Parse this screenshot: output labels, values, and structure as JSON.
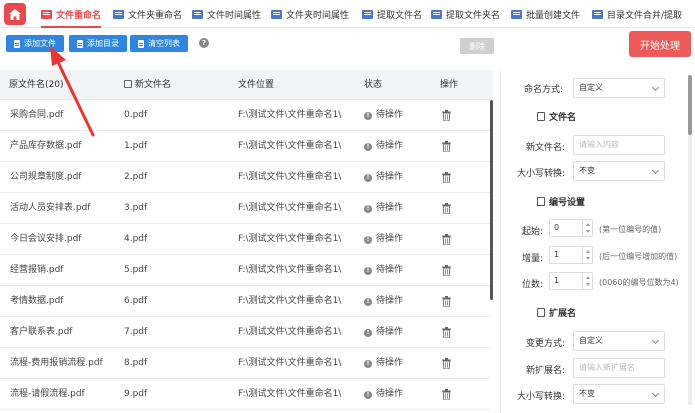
{
  "nav": {
    "tabs": [
      {
        "label": "文件重命名",
        "active": true
      },
      {
        "label": "文件夹重命名"
      },
      {
        "label": "文件时间属性"
      },
      {
        "label": "文件夹时间属性"
      },
      {
        "label": "提取文件名"
      },
      {
        "label": "提取文件夹名"
      },
      {
        "label": "批量创建文件"
      },
      {
        "label": "目录文件合并/提取"
      }
    ]
  },
  "toolbar": {
    "add_file": "添加文件",
    "add_folder": "添加目录",
    "clear_list": "清空列表",
    "help": "?",
    "delete": "删除",
    "start": "开始处理"
  },
  "table": {
    "headers": [
      "原文件名(20)",
      "新文件名",
      "文件位置",
      "状态",
      "操作"
    ],
    "rows": [
      {
        "orig": "采购合同.pdf",
        "new": "0.pdf",
        "path": "F:\\测试文件\\文件重命名1\\",
        "status": "待操作"
      },
      {
        "orig": "产品库存数据.pdf",
        "new": "1.pdf",
        "path": "F:\\测试文件\\文件重命名1\\",
        "status": "待操作"
      },
      {
        "orig": "公司规章制度.pdf",
        "new": "2.pdf",
        "path": "F:\\测试文件\\文件重命名1\\",
        "status": "待操作"
      },
      {
        "orig": "活动人员安排表.pdf",
        "new": "3.pdf",
        "path": "F:\\测试文件\\文件重命名1\\",
        "status": "待操作"
      },
      {
        "orig": "今日会议安排.pdf",
        "new": "4.pdf",
        "path": "F:\\测试文件\\文件重命名1\\",
        "status": "待操作"
      },
      {
        "orig": "经营报销.pdf",
        "new": "5.pdf",
        "path": "F:\\测试文件\\文件重命名1\\",
        "status": "待操作"
      },
      {
        "orig": "考情数据.pdf",
        "new": "6.pdf",
        "path": "F:\\测试文件\\文件重命名1\\",
        "status": "待操作"
      },
      {
        "orig": "客户联系表.pdf",
        "new": "7.pdf",
        "path": "F:\\测试文件\\文件重命名1\\",
        "status": "待操作"
      },
      {
        "orig": "流程-费用报销流程.pdf",
        "new": "8.pdf",
        "path": "F:\\测试文件\\文件重命名1\\",
        "status": "待操作"
      },
      {
        "orig": "流程-请假流程.pdf",
        "new": "9.pdf",
        "path": "F:\\测试文件\\文件重命名1\\",
        "status": "待操作"
      }
    ]
  },
  "panel": {
    "naming_mode_label": "命名方式:",
    "naming_mode_value": "自定义",
    "filename_section": "文件名",
    "new_name_label": "新文件名:",
    "new_name_placeholder": "请输入内容",
    "case_label": "大小写转换:",
    "case_value": "不变",
    "number_section": "编号设置",
    "start_label": "起始:",
    "start_value": "0",
    "start_hint": "(第一位编号的值)",
    "step_label": "增量:",
    "step_value": "1",
    "step_hint": "(后一位编号增加的值)",
    "digits_label": "位数:",
    "digits_value": "1",
    "digits_hint": "(0060的编号位数为4)",
    "ext_section": "扩展名",
    "ext_mode_label": "变更方式:",
    "ext_mode_value": "自定义",
    "new_ext_label": "新扩展名:",
    "new_ext_placeholder": "请输入新扩展名",
    "ext_case_label": "大小写转换:",
    "ext_case_value": "不变"
  }
}
